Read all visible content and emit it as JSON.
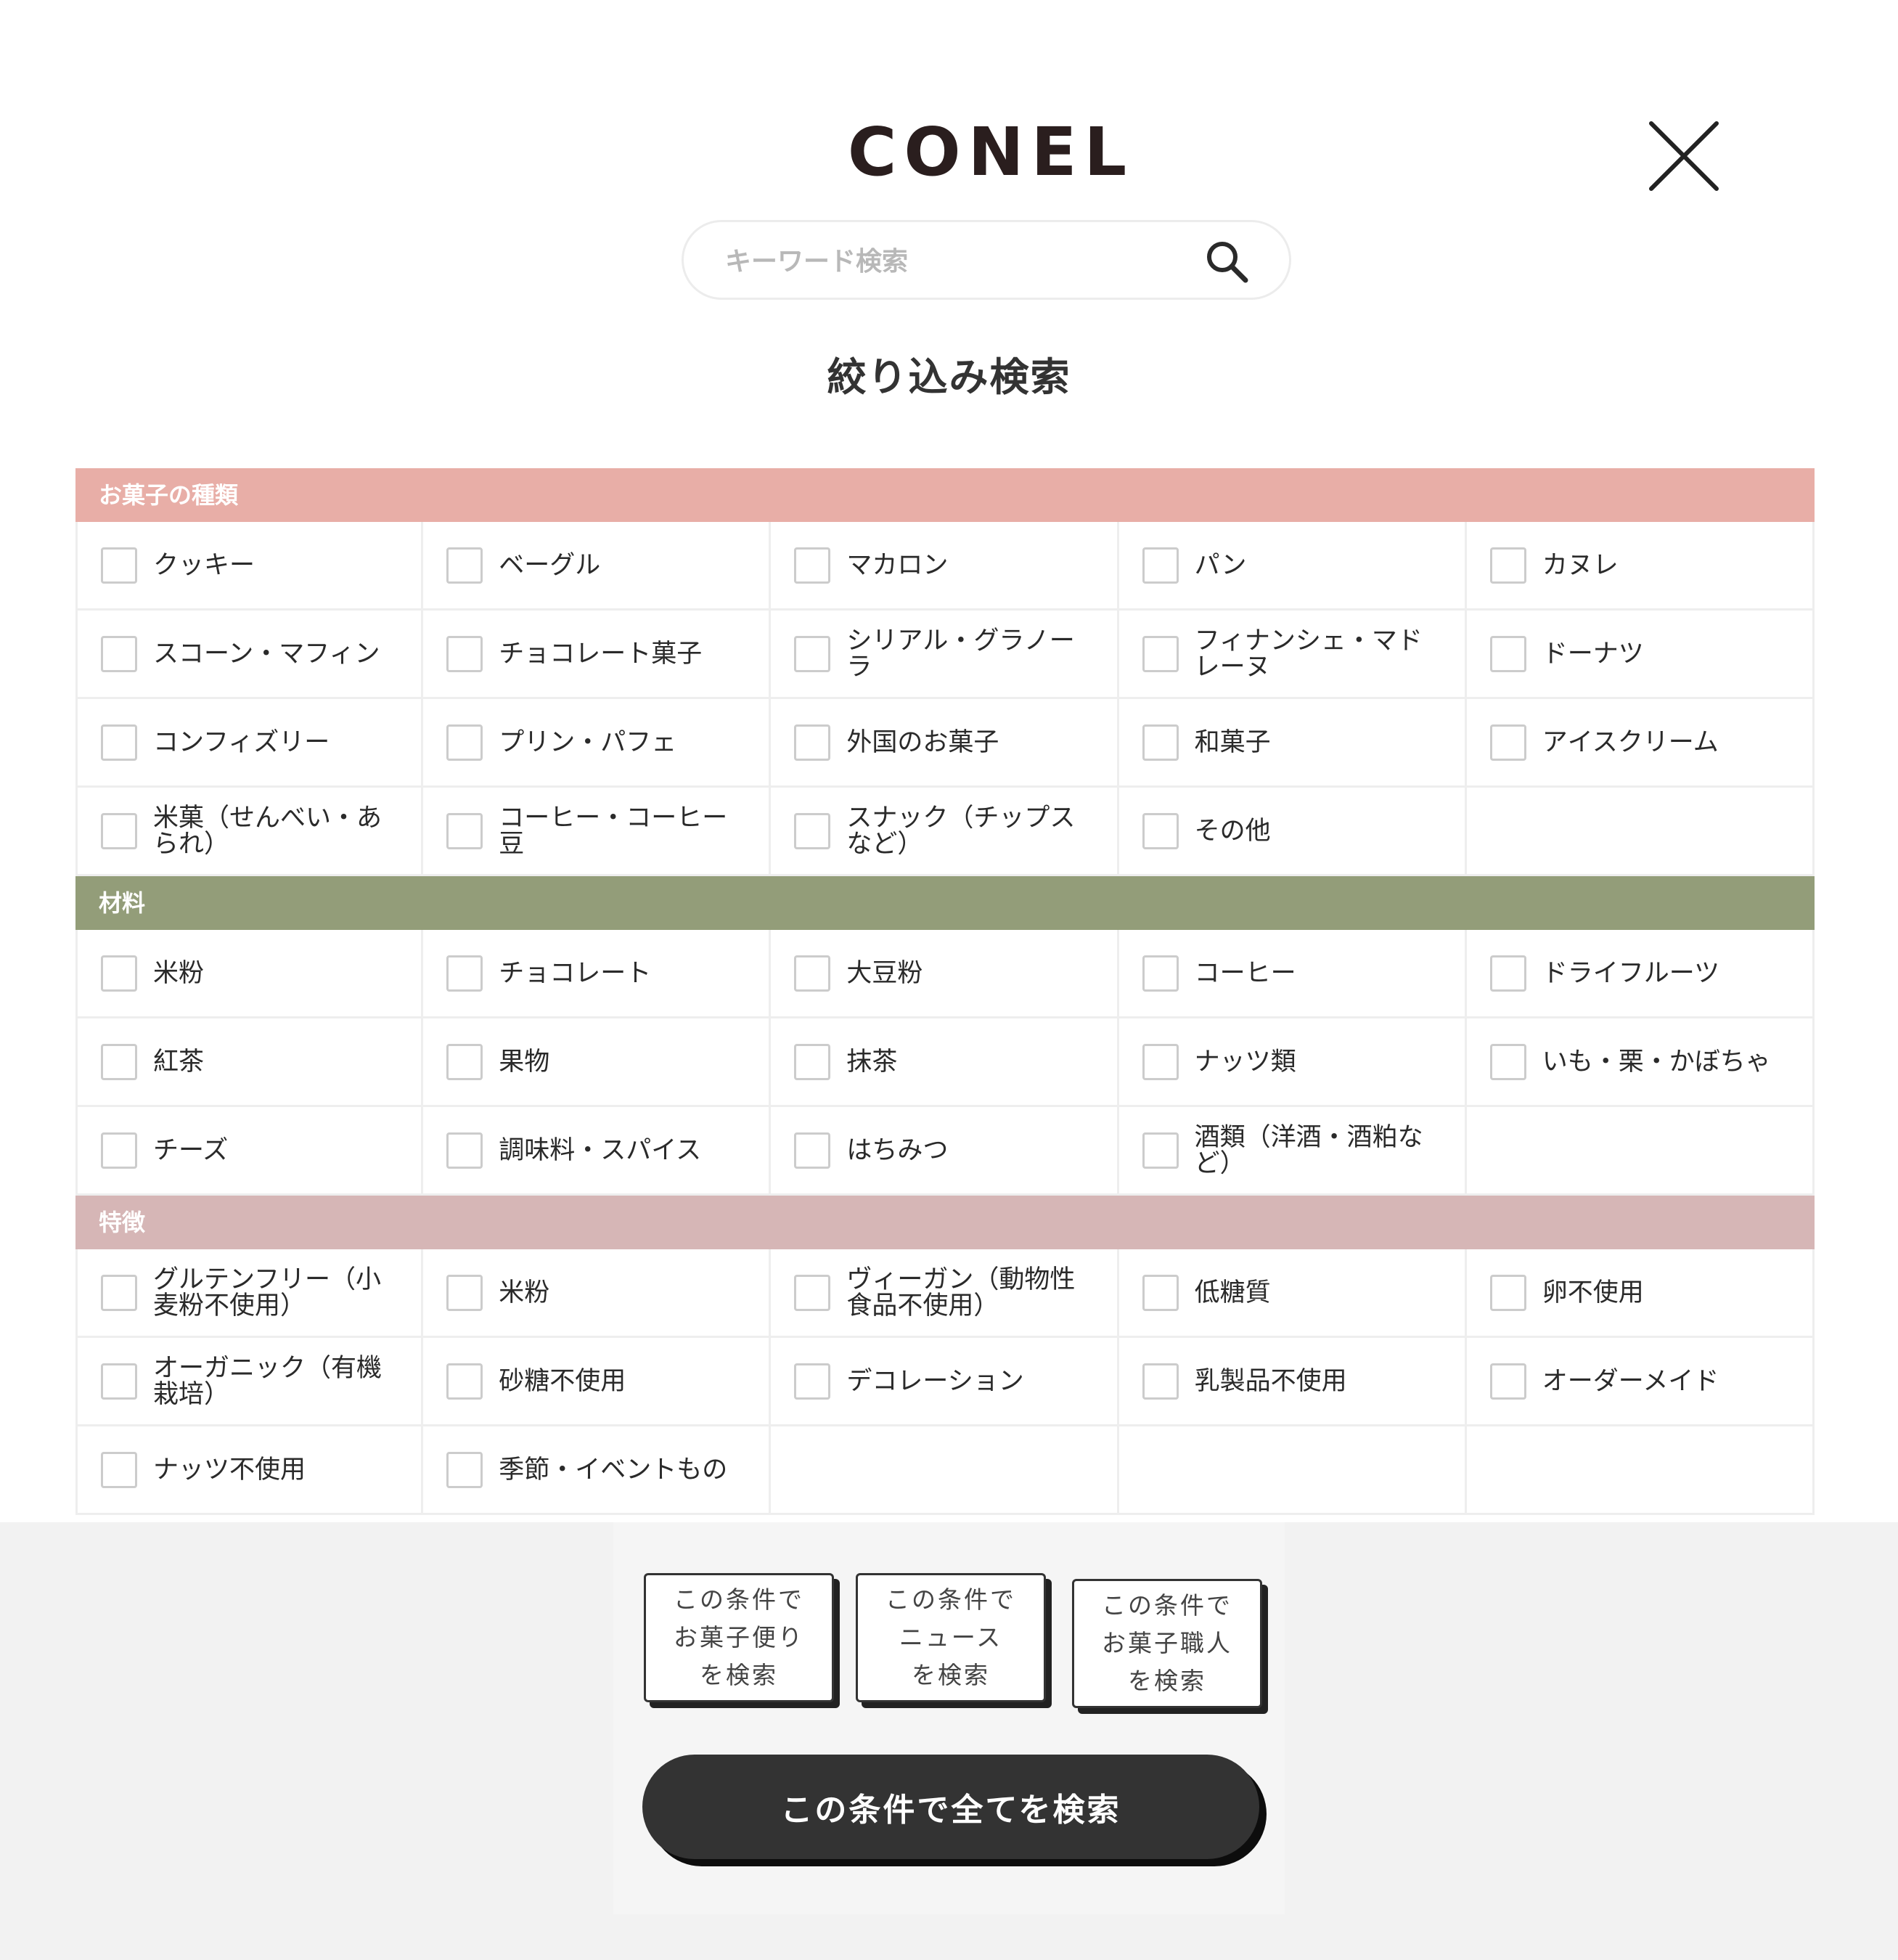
{
  "header": {
    "logo_text": "CONEL",
    "search_placeholder": "キーワード検索"
  },
  "title": "絞り込み検索",
  "categories": [
    {
      "id": "okashi",
      "label": "お菓子の種類",
      "color": "#e8aea7",
      "items": [
        [
          "クッキー",
          "ベーグル",
          "マカロン",
          "パン",
          "カヌレ"
        ],
        [
          "スコーン・マフィン",
          "チョコレート菓子",
          "シリアル・グラノーラ",
          "フィナンシェ・マドレーヌ",
          "ドーナツ"
        ],
        [
          "コンフィズリー",
          "プリン・パフェ",
          "外国のお菓子",
          "和菓子",
          "アイスクリーム"
        ],
        [
          "米菓（せんべい・あられ）",
          "コーヒー・コーヒー豆",
          "スナック（チップスなど）",
          "その他"
        ]
      ]
    },
    {
      "id": "zairyo",
      "label": "材料",
      "color": "#939d79",
      "items": [
        [
          "米粉",
          "チョコレート",
          "大豆粉",
          "コーヒー",
          "ドライフルーツ"
        ],
        [
          "紅茶",
          "果物",
          "抹茶",
          "ナッツ類",
          "いも・栗・かぼちゃ"
        ],
        [
          "チーズ",
          "調味料・スパイス",
          "はちみつ",
          "酒類（洋酒・酒粕など）"
        ]
      ]
    },
    {
      "id": "tokucho",
      "label": "特徴",
      "color": "#d6b6b6",
      "items": [
        [
          "グルテンフリー（小麦粉不使用）",
          "米粉",
          "ヴィーガン（動物性食品不使用）",
          "低糖質",
          "卵不使用"
        ],
        [
          "オーガニック（有機栽培）",
          "砂糖不使用",
          "デコレーション",
          "乳製品不使用",
          "オーダーメイド"
        ],
        [
          "ナッツ不使用",
          "季節・イベントもの"
        ]
      ]
    }
  ],
  "footer": {
    "btn_okashi_dayori": "この条件で\nお菓子便り\nを検索",
    "btn_news": "この条件で\nニュース\nを検索",
    "btn_shokunin": "この条件で\nお菓子職人\nを検索",
    "btn_all": "この条件で全てを検索"
  }
}
